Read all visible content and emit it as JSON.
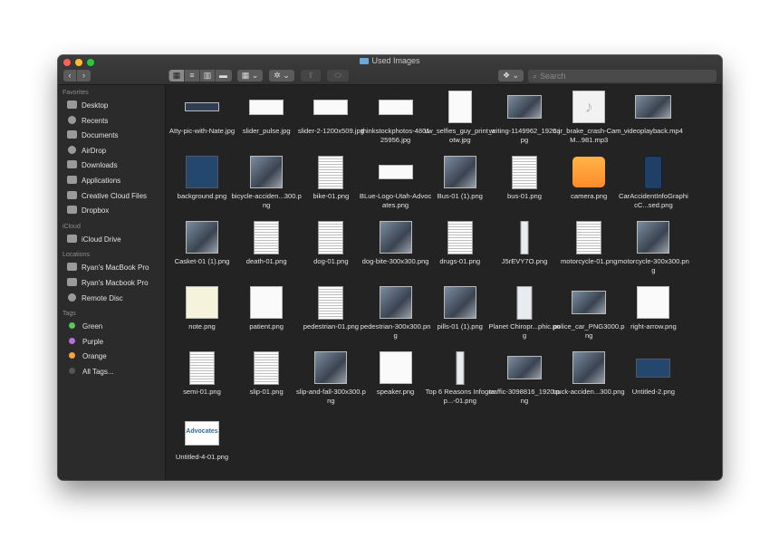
{
  "window": {
    "title": "Used Images"
  },
  "toolbar": {
    "back": "‹",
    "forward": "›",
    "view_icons": "▦",
    "view_list": "≡",
    "view_columns": "▥",
    "view_gallery": "▬",
    "group": "▦ ⌄",
    "action": "✲ ⌄",
    "share": "⇪",
    "tag": "⬭",
    "dropbox": "❖ ⌄"
  },
  "search": {
    "placeholder": "Search",
    "icon": "⌕"
  },
  "sidebar": {
    "favorites_head": "Favorites",
    "favorites": [
      {
        "label": "Desktop",
        "icon": "desktop-icon"
      },
      {
        "label": "Recents",
        "icon": "recents-icon"
      },
      {
        "label": "Documents",
        "icon": "documents-icon"
      },
      {
        "label": "AirDrop",
        "icon": "airdrop-icon"
      },
      {
        "label": "Downloads",
        "icon": "downloads-icon"
      },
      {
        "label": "Applications",
        "icon": "applications-icon"
      },
      {
        "label": "Creative Cloud Files",
        "icon": "creative-cloud-icon"
      },
      {
        "label": "Dropbox",
        "icon": "dropbox-icon"
      }
    ],
    "icloud_head": "iCloud",
    "icloud": [
      {
        "label": "iCloud Drive",
        "icon": "cloud-icon"
      }
    ],
    "locations_head": "Locations",
    "locations": [
      {
        "label": "Ryan's MacBook Pro",
        "icon": "laptop-icon"
      },
      {
        "label": "Ryan's Macbook Pro",
        "icon": "disk-icon"
      },
      {
        "label": "Remote Disc",
        "icon": "disc-icon"
      }
    ],
    "tags_head": "Tags",
    "tags": [
      {
        "label": "Green",
        "color": "#5cc45a"
      },
      {
        "label": "Purple",
        "color": "#b46fe0"
      },
      {
        "label": "Orange",
        "color": "#f5a441"
      },
      {
        "label": "All Tags...",
        "color": "#555555"
      }
    ]
  },
  "files": [
    {
      "name": "Atty-pic-with-Nate.jpg",
      "kind": "banner"
    },
    {
      "name": "slider_pulse.jpg",
      "kind": "wide"
    },
    {
      "name": "slider-2-1200x509.jpg",
      "kind": "wide"
    },
    {
      "name": "thinkstockphotos-480125956.jpg",
      "kind": "wide"
    },
    {
      "name": "vw_selfies_guy_print_aotw.jpg",
      "kind": "tall"
    },
    {
      "name": "writing-1149962_1920.jpg",
      "kind": "wide-photo"
    },
    {
      "name": "car_brake_crash-Cam_M...981.mp3",
      "kind": "music"
    },
    {
      "name": "videoplayback.mp4",
      "kind": "video"
    },
    {
      "name": "background.png",
      "kind": "blue"
    },
    {
      "name": "bicycle-acciden...300.png",
      "kind": "photo"
    },
    {
      "name": "bike-01.png",
      "kind": "doc"
    },
    {
      "name": "BLue-Logo-Utah-Advocates.png",
      "kind": "white-wide"
    },
    {
      "name": "Bus-01 (1).png",
      "kind": "photo"
    },
    {
      "name": "bus-01.png",
      "kind": "doc"
    },
    {
      "name": "camera.png",
      "kind": "camera"
    },
    {
      "name": "CarAccidentInfoGraphicC...sed.png",
      "kind": "phone"
    },
    {
      "name": "Casket-01 (1).png",
      "kind": "photo"
    },
    {
      "name": "death-01.png",
      "kind": "doc"
    },
    {
      "name": "dog-01.png",
      "kind": "doc"
    },
    {
      "name": "dog-bite-300x300.png",
      "kind": "photo"
    },
    {
      "name": "drugs-01.png",
      "kind": "doc"
    },
    {
      "name": "J5rEVY7O.png",
      "kind": "strip"
    },
    {
      "name": "motorcycle-01.png",
      "kind": "doc"
    },
    {
      "name": "motorcycle-300x300.png",
      "kind": "photo"
    },
    {
      "name": "note.png",
      "kind": "note"
    },
    {
      "name": "patient.png",
      "kind": "white"
    },
    {
      "name": "pedestrian-01.png",
      "kind": "doc"
    },
    {
      "name": "pedestrian-300x300.png",
      "kind": "photo"
    },
    {
      "name": "pills-01 (1).png",
      "kind": "photo"
    },
    {
      "name": "Planet Chiropr...phic.png",
      "kind": "phone-light"
    },
    {
      "name": "police_car_PNG3000.png",
      "kind": "wide-photo"
    },
    {
      "name": "right-arrow.png",
      "kind": "white"
    },
    {
      "name": "semi-01.png",
      "kind": "doc"
    },
    {
      "name": "slip-01.png",
      "kind": "doc"
    },
    {
      "name": "slip-and-fall-300x300.png",
      "kind": "photo"
    },
    {
      "name": "speaker.png",
      "kind": "white"
    },
    {
      "name": "Top 6 Reasons Infograp...-01.png",
      "kind": "strip"
    },
    {
      "name": "traffic-3098816_1920.png",
      "kind": "wide-photo"
    },
    {
      "name": "truck-acciden...300.png",
      "kind": "photo"
    },
    {
      "name": "Untitled-2.png",
      "kind": "wide-dark"
    },
    {
      "name": "Untitled-4-01.png",
      "kind": "advocates",
      "thumb_text": "Advocates"
    }
  ],
  "colors": {
    "window_bg": "#232323",
    "sidebar_bg": "#2b2b2b",
    "accent": "#6fa6d9"
  }
}
